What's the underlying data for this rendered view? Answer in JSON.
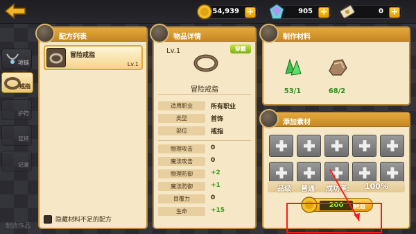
{
  "currencies": {
    "gold": "54,939",
    "gems": "905",
    "tickets": "0"
  },
  "side_tabs": [
    {
      "label": "项链"
    },
    {
      "label": "戒指"
    },
    {
      "label": "护符"
    },
    {
      "label": "耳环"
    },
    {
      "label": "记录"
    }
  ],
  "bottom_hint": "制造饰品",
  "recipe_panel": {
    "title": "配方列表",
    "item_name": "冒险戒指",
    "item_level": "Lv.1",
    "hide_label": "隐藏材料不足的配方"
  },
  "detail_panel": {
    "title": "物品详情",
    "level": "Lv.1",
    "badge": "穿戴",
    "name": "冒险戒指",
    "info": [
      {
        "key": "适用职业",
        "value": "所有职业"
      },
      {
        "key": "类型",
        "value": "首饰"
      },
      {
        "key": "部位",
        "value": "戒指"
      }
    ],
    "stats": [
      {
        "key": "物理攻击",
        "value": "0"
      },
      {
        "key": "魔法攻击",
        "value": "0"
      },
      {
        "key": "物理防御",
        "value": "+2"
      },
      {
        "key": "魔法防御",
        "value": "+1"
      },
      {
        "key": "目覆力",
        "value": "0"
      },
      {
        "key": "生命",
        "value": "+15"
      }
    ]
  },
  "materials_panel": {
    "title": "制作材料",
    "materials": [
      {
        "icon": "green-crystal-icon",
        "count": "53/1"
      },
      {
        "icon": "ore-icon",
        "count": "68/2"
      }
    ]
  },
  "add_panel": {
    "title": "添加素材",
    "rate_parts": [
      "品级",
      "普通",
      "成功率:",
      "100%"
    ],
    "cost": "200",
    "craft_label": "制造"
  }
}
